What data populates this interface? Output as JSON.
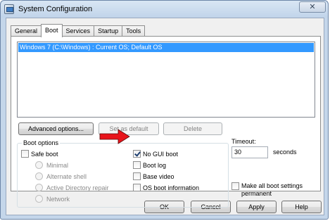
{
  "window": {
    "title": "System Configuration"
  },
  "tabs": [
    {
      "label": "General",
      "active": false
    },
    {
      "label": "Boot",
      "active": true
    },
    {
      "label": "Services",
      "active": false
    },
    {
      "label": "Startup",
      "active": false
    },
    {
      "label": "Tools",
      "active": false
    }
  ],
  "os_list": {
    "items": [
      "Windows 7 (C:\\Windows) : Current OS; Default OS"
    ],
    "selected_index": 0
  },
  "list_buttons": {
    "advanced": "Advanced options...",
    "set_default": "Set as default",
    "delete": "Delete"
  },
  "boot_options": {
    "title": "Boot options",
    "safe_boot": {
      "label": "Safe boot",
      "checked": false
    },
    "radios": [
      "Minimal",
      "Alternate shell",
      "Active Directory repair",
      "Network"
    ],
    "no_gui_boot": {
      "label": "No GUI boot",
      "checked": true
    },
    "boot_log": {
      "label": "Boot log",
      "checked": false
    },
    "base_video": {
      "label": "Base video",
      "checked": false
    },
    "os_boot_info": {
      "label": "OS boot information",
      "checked": false
    }
  },
  "timeout": {
    "label": "Timeout:",
    "value": "30",
    "units": "seconds"
  },
  "make_permanent": {
    "line1": "Make all boot settings",
    "line2": "permanent",
    "checked": false
  },
  "dialog_buttons": {
    "ok": "OK",
    "cancel": "Cancel",
    "apply": "Apply",
    "help": "Help"
  },
  "annotation": {
    "arrow_color": "#e8141b"
  },
  "colors": {
    "selection": "#3399ff",
    "frame": "#c4d6ea"
  }
}
